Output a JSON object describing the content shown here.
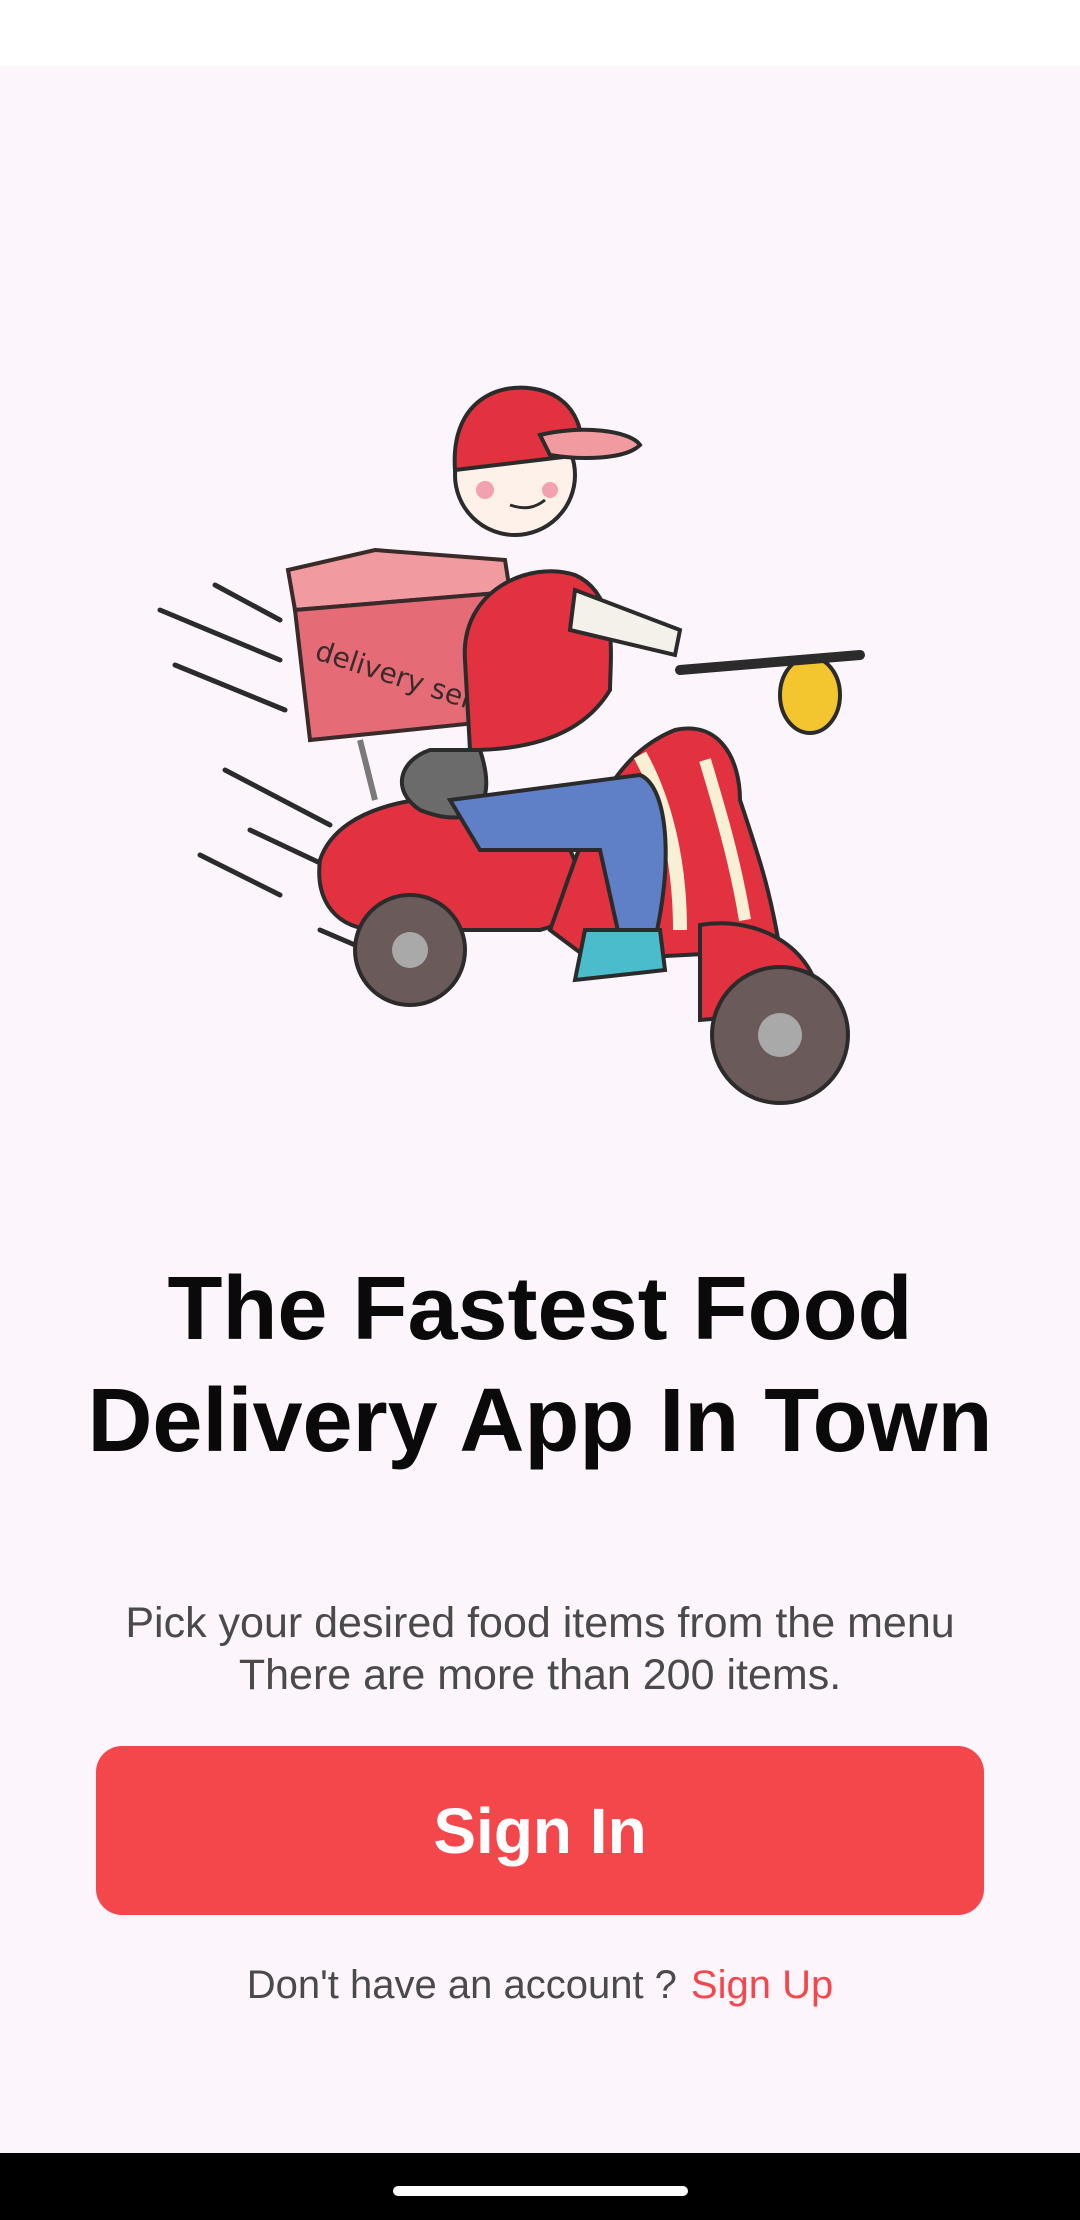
{
  "onboarding": {
    "illustration_icon": "delivery-scooter-illustration",
    "illustration_box_text": "delivery service",
    "title": "The Fastest Food Delivery App In Town",
    "subtitle_line1": "Pick your desired food items from the menu",
    "subtitle_line2": "There are more than 200 items.",
    "signin_label": "Sign In",
    "signup_prompt": "Don't have an account ?",
    "signup_label": "Sign Up"
  },
  "colors": {
    "accent": "#f4474b",
    "background": "#fdf5fc"
  }
}
